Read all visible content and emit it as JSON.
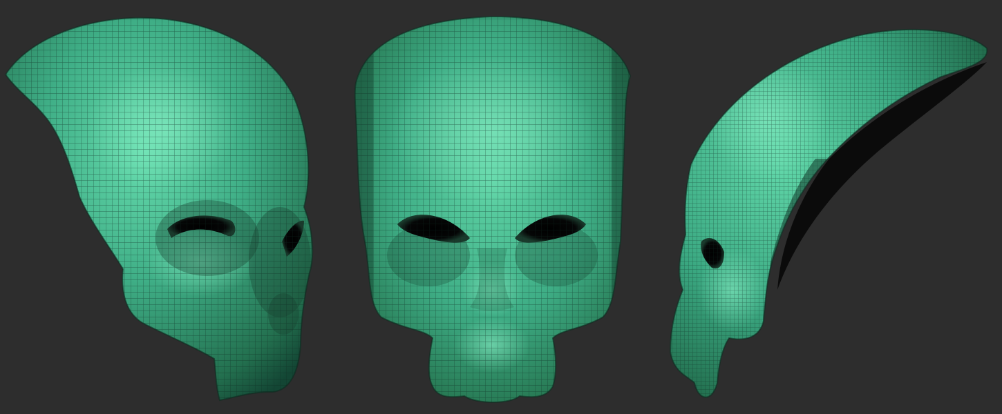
{
  "viewport": {
    "background": "#2d2d2d",
    "views": [
      {
        "id": "three-quarter",
        "subject": "alien-skull-sculpt"
      },
      {
        "id": "front",
        "subject": "alien-skull-sculpt"
      },
      {
        "id": "side",
        "subject": "alien-skull-sculpt"
      }
    ]
  },
  "material": {
    "base_color": "#3fae86",
    "highlight_color": "#66dcae",
    "shadow_color": "#134634",
    "wire_color": "#0f2a20",
    "cavity_color": "#050606"
  }
}
